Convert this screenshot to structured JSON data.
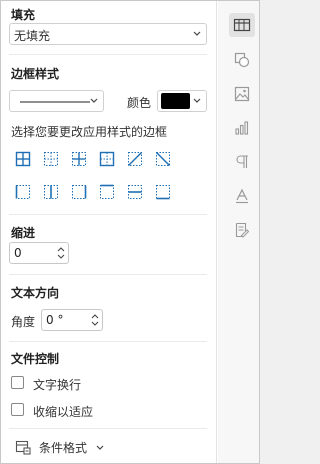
{
  "fill": {
    "heading": "填充",
    "value": "无填充"
  },
  "border_style": {
    "heading": "边框样式",
    "color_label": "颜色",
    "color_value": "#000000",
    "instruction": "选择您要更改应用样式的边框",
    "buttons": [
      "all-borders-icon",
      "inner-borders-icon",
      "inner-cross-icon",
      "outer-border-icon",
      "diagonal-up-icon",
      "diagonal-down-icon",
      "left-border-icon",
      "vertical-center-border-icon",
      "right-border-icon",
      "top-border-icon",
      "horizontal-center-border-icon",
      "bottom-border-icon"
    ]
  },
  "indent": {
    "heading": "缩进",
    "value": "0"
  },
  "text_direction": {
    "heading": "文本方向",
    "angle_label": "角度",
    "angle_value": "0 °"
  },
  "text_control": {
    "heading": "文件控制",
    "wrap_label": "文字换行",
    "shrink_label": "收缩以适应",
    "wrap_checked": false,
    "shrink_checked": false
  },
  "conditional_format": {
    "label": "条件格式"
  },
  "rail": {
    "items": [
      "cell-settings-icon",
      "shape-settings-icon",
      "image-settings-icon",
      "chart-settings-icon",
      "paragraph-settings-icon",
      "text-art-icon",
      "signature-settings-icon"
    ],
    "active_index": 0
  }
}
